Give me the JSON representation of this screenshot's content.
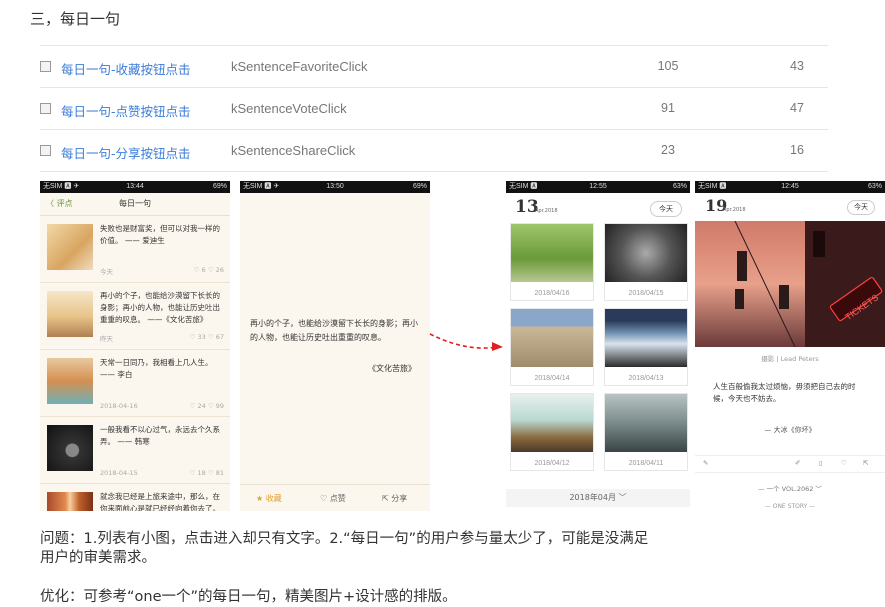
{
  "section_title": "三，每日一句",
  "rows": [
    {
      "name": "每日一句-收藏按钮点击",
      "code": "kSentenceFavoriteClick",
      "v1": "105",
      "v2": "43"
    },
    {
      "name": "每日一句-点赞按钮点击",
      "code": "kSentenceVoteClick",
      "v1": "91",
      "v2": "47"
    },
    {
      "name": "每日一句-分享按钮点击",
      "code": "kSentenceShareClick",
      "v1": "23",
      "v2": "16"
    }
  ],
  "phone1": {
    "status_left": "无SIM 🅰 ✈",
    "status_time": "13:44",
    "status_right": "69%",
    "back": "〈 评点",
    "title": "每日一句",
    "items": [
      {
        "text": "失败也是财富奖，但可以对我一样的价值。 —— 爱迪生",
        "meta": "今天",
        "stats": "♡ 6  ♡ 26"
      },
      {
        "text": "再小的个子，也能给沙漠留下长长的身影；再小的人物，也能让历史吐出重重的叹息。 ——《文化苦旅》",
        "meta": "昨天",
        "stats": "♡ 33 ♡ 67"
      },
      {
        "text": "天常一日同乃，我相看上几人生。 —— 李白",
        "meta": "2018-04-16",
        "stats": "♡ 24 ♡ 99"
      },
      {
        "text": "一般我看不以心过气，永远去个久系弄。 —— 韩寒",
        "meta": "2018-04-15",
        "stats": "♡ 18 ♡ 81"
      },
      {
        "text": "就念我已经是上旅来途中，那么，在你来面前心是就已经经向着你去了。 —— 席慕蓉",
        "meta": "",
        "stats": ""
      }
    ]
  },
  "phone2": {
    "status_left": "无SIM 🅰 ✈",
    "status_time": "13:50",
    "status_right": "69%",
    "quote": "再小的个子，也能给沙漠留下长长的身影；再小的人物，也能让历史吐出重重的叹息。",
    "source": "《文化苦旅》",
    "fav": "★ 收藏",
    "like": "♡ 点赞",
    "share": "⇱ 分享"
  },
  "phone3": {
    "status_left": "无SIM 🅰",
    "status_time": "12:55",
    "status_right": "63%",
    "day": "13",
    "month": "Apr.2018",
    "today": "今天",
    "cards": [
      "2018/04/16",
      "2018/04/15",
      "2018/04/14",
      "2018/04/13",
      "2018/04/12",
      "2018/04/11"
    ],
    "footer": "2018年04月 ﹀"
  },
  "phone4": {
    "status_left": "无SIM 🅰",
    "status_time": "12:45",
    "status_right": "63%",
    "day": "19",
    "month": "Apr.2018",
    "today": "今天",
    "sign_text": "TICKETS",
    "credit": "摄影 | Lead Peters",
    "body": "人生百般偷我太过烦恼，毋须把自己去的时候，今天也不妨去。",
    "author": "— 大冰《你坏》",
    "vol": "— 一个 VOL.2062 ﹀",
    "story": "— ONE STORY —"
  },
  "issue": "问题：1.列表有小图，点击进入却只有文字。2.“每日一句”的用户参与量太少了，可能是没满足用户的审美需求。",
  "issue_line1": "问题：1.列表有小图，点击进入却只有文字。2.“每日一句”的用户参与量太少了，可能是没满足",
  "issue_line2": "用户的审美需求。",
  "optimize": "优化：可参考“one一个”的每日一句，精美图片+设计感的排版。"
}
